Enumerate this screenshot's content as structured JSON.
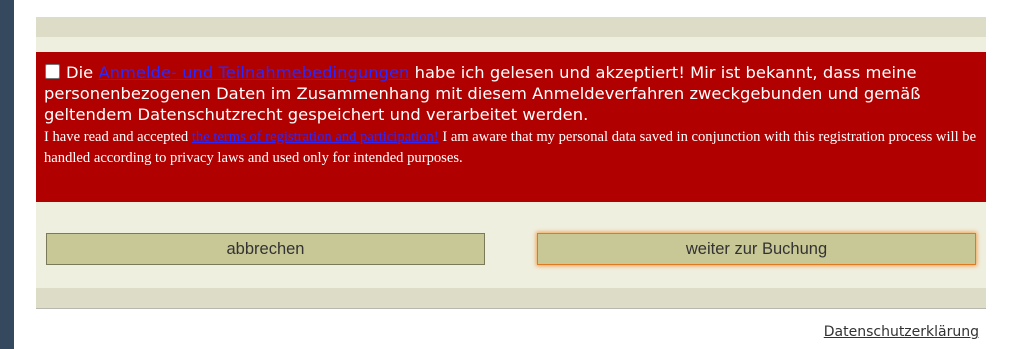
{
  "consent": {
    "de_prefix": "Die ",
    "de_link": "Anmelde- und Teilnahmebedingungen",
    "de_suffix": " habe ich gelesen und akzeptiert! Mir ist bekannt, dass meine personenbezogenen Daten im Zusammenhang mit diesem Anmeldeverfahren zweckgebunden und gemäß geltendem Datenschutzrecht gespeichert und verarbeitet werden.",
    "en_prefix": "I have read and accepted ",
    "en_link": "the terms of registration and participation!",
    "en_suffix": " I am aware that my personal data saved in conjunction with this registration process will be handled according to privacy laws and used only for intended purposes.",
    "checked": false
  },
  "buttons": {
    "cancel": "abbrechen",
    "continue": "weiter zur Buchung"
  },
  "footer": {
    "privacy_link": "Datenschutzerklärung"
  },
  "colors": {
    "consent_bg": "#b00000",
    "panel_bg": "#efefe0",
    "button_bg": "#c8c796",
    "focus_outline": "#f0a050",
    "link": "#2929ff"
  }
}
